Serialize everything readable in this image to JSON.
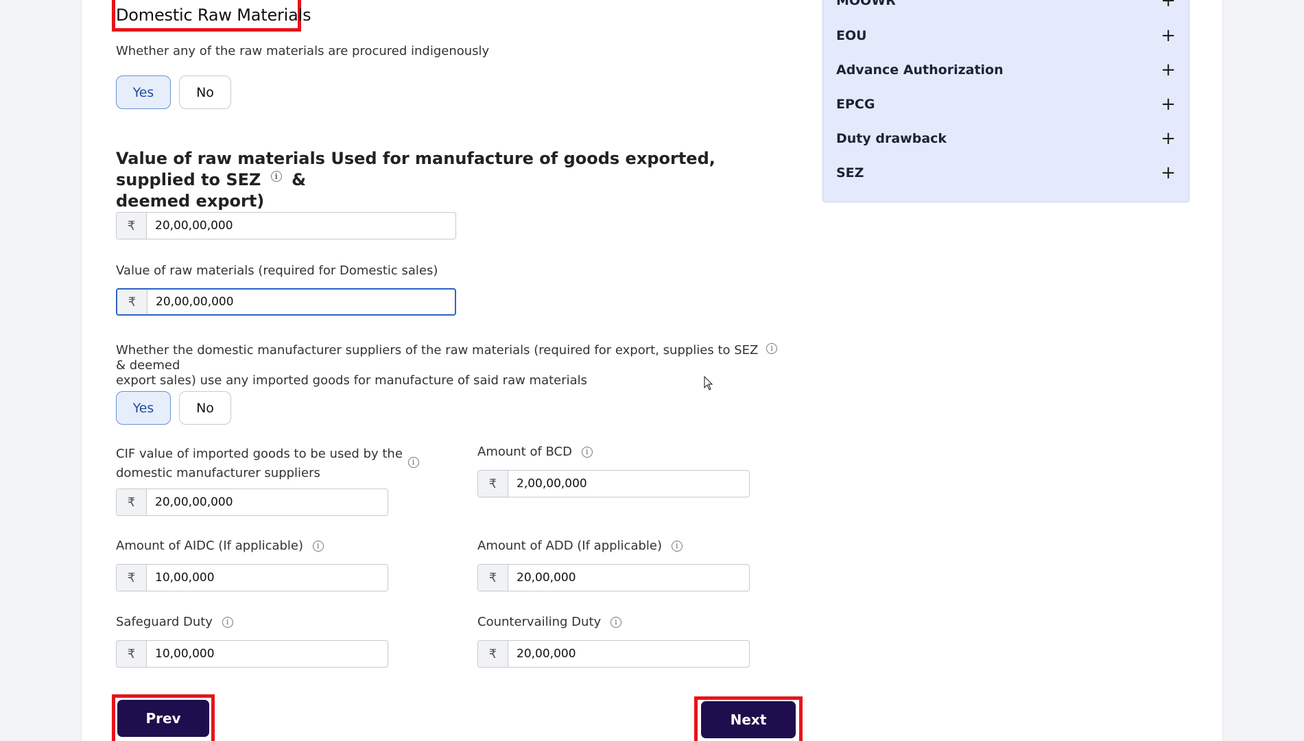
{
  "section": {
    "title": "Domestic Raw Materials",
    "question1": "Whether any of the raw materials are procured indigenously",
    "yes_label": "Yes",
    "no_label": "No"
  },
  "value_heading": {
    "line1": "Value of raw materials Used for manufacture of goods exported, supplied to SEZ",
    "line1_suffix": "&",
    "line2": "deemed export)"
  },
  "currency_symbol": "₹",
  "info_glyph": "i",
  "fields": {
    "export_value": "20,00,00,000",
    "domestic_label": "Value of raw materials (required for Domestic sales)",
    "domestic_value": "20,00,00,000"
  },
  "question2": {
    "line1": "Whether the domestic manufacturer suppliers of the raw materials (required for export, supplies to SEZ",
    "line1_suffix": "& deemed",
    "line2": "export sales) use any imported goods for manufacture of said raw materials",
    "yes_label": "Yes",
    "no_label": "No"
  },
  "duties": {
    "cif_label_line1": "CIF value of imported goods to be used by the",
    "cif_label_line2": "domestic manufacturer suppliers",
    "cif_value": "20,00,00,000",
    "bcd_label": "Amount of BCD",
    "bcd_value": "2,00,00,000",
    "aidc_label": "Amount of AIDC (If applicable)",
    "aidc_value": "10,00,000",
    "add_label": "Amount of ADD (If applicable)",
    "add_value": "20,00,000",
    "safeguard_label": "Safeguard Duty",
    "safeguard_value": "10,00,000",
    "countervailing_label": "Countervailing Duty",
    "countervailing_value": "20,00,000"
  },
  "sidebar": {
    "items": [
      {
        "label": "MOOWR",
        "icon": "plus-icon"
      },
      {
        "label": "EOU",
        "icon": "plus-icon"
      },
      {
        "label": "Advance Authorization",
        "icon": "plus-icon"
      },
      {
        "label": "EPCG",
        "icon": "plus-icon"
      },
      {
        "label": "Duty drawback",
        "icon": "plus-icon"
      },
      {
        "label": "SEZ",
        "icon": "plus-icon"
      }
    ],
    "plus_glyph": "+"
  },
  "nav": {
    "prev_label": "Prev",
    "next_label": "Next"
  },
  "colors": {
    "nav_button": "#1f0e4d",
    "highlight_box": "#e6141b",
    "sidebar_bg": "#e4eafb",
    "selected_toggle": "#e6eefb"
  }
}
